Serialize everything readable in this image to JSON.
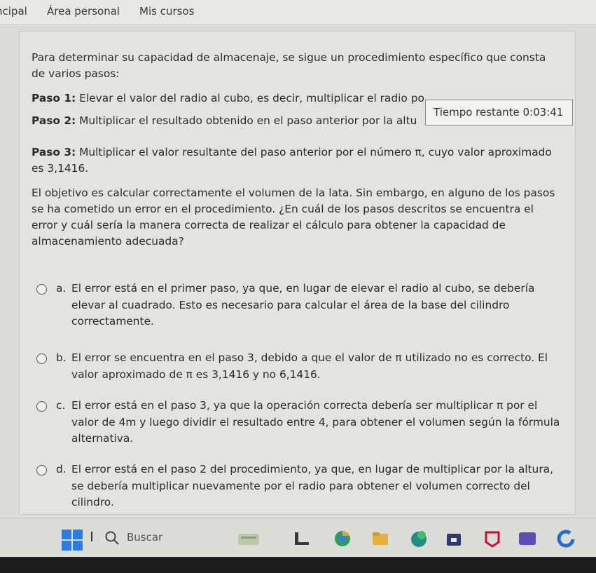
{
  "nav": {
    "items": [
      "ncipal",
      "Área personal",
      "Mis cursos"
    ]
  },
  "timer": {
    "label": "Tiempo restante 0:03:41"
  },
  "question": {
    "intro": "Para determinar su capacidad de almacenaje, se sigue un procedimiento específico que consta de varios pasos:",
    "steps": [
      {
        "label": "Paso 1:",
        "text": " Elevar el valor del radio al cubo, es decir, multiplicar el radio po"
      },
      {
        "label": "Paso 2:",
        "text": " Multiplicar el resultado obtenido en el paso anterior por la altu"
      },
      {
        "label": "Paso 3:",
        "text": " Multiplicar el valor resultante del paso anterior por el número π, cuyo valor aproximado es 3,1416."
      }
    ],
    "prompt": "El objetivo es calcular correctamente el volumen de la lata. Sin embargo, en alguno de los pasos se ha cometido un error en el procedimiento. ¿En cuál de los pasos descritos se encuentra el error y cuál sería la manera correcta de realizar el cálculo para obtener la capacidad de almacenamiento adecuada?",
    "options": [
      {
        "letter": "a.",
        "text": "El error está en el primer paso, ya que, en lugar de elevar el radio al cubo, se debería elevar al cuadrado. Esto es necesario para calcular el área de la base del cilindro correctamente."
      },
      {
        "letter": "b.",
        "text": "El error se encuentra en el paso 3, debido a que el valor de π utilizado no es correcto. El valor aproximado de π es 3,1416 y no 6,1416."
      },
      {
        "letter": "c.",
        "text": "El error está en el paso 3, ya que la operación correcta debería ser multiplicar π por el valor de 4m y luego dividir el resultado entre 4, para obtener el volumen según la fórmula alternativa."
      },
      {
        "letter": "d.",
        "text": "El error está en el paso 2 del procedimiento, ya que, en lugar de multiplicar por la altura, se debería multiplicar nuevamente por el radio para obtener el volumen correcto del cilindro."
      }
    ]
  },
  "taskbar": {
    "search_placeholder": "Buscar",
    "icons": [
      "windows-start-icon",
      "search-icon",
      "weather-widget-icon",
      "file-explorer-icon",
      "chrome-icon",
      "folder-icon",
      "edge-icon",
      "store-icon",
      "mcafee-icon",
      "app-icon",
      "edge-browser-icon"
    ],
    "colors": {
      "windows": "#2a7de1",
      "accent": "#1f6fd1"
    }
  }
}
